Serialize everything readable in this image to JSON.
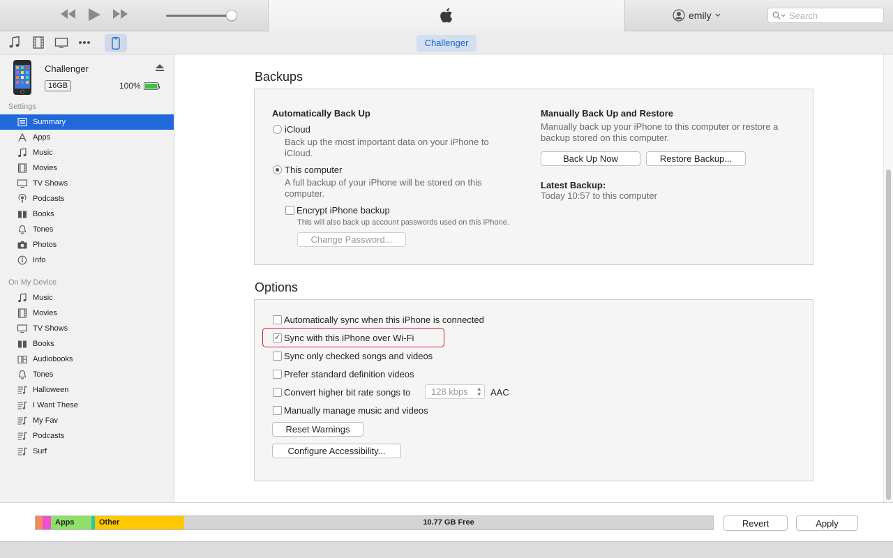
{
  "toolbar": {
    "icons": [
      "rewind-icon",
      "play-icon",
      "fast-forward-icon"
    ],
    "user_name": "emily",
    "search_placeholder": "Search"
  },
  "subbar": {
    "device_tab": "Challenger"
  },
  "device": {
    "name": "Challenger",
    "capacity": "16GB",
    "battery": "100%"
  },
  "sidebar": {
    "settings_label": "Settings",
    "settings_items": [
      {
        "label": "Summary",
        "icon": "summary-icon",
        "active": true
      },
      {
        "label": "Apps",
        "icon": "apps-icon"
      },
      {
        "label": "Music",
        "icon": "music-note-icon"
      },
      {
        "label": "Movies",
        "icon": "film-icon"
      },
      {
        "label": "TV Shows",
        "icon": "tv-icon"
      },
      {
        "label": "Podcasts",
        "icon": "podcast-icon"
      },
      {
        "label": "Books",
        "icon": "book-icon"
      },
      {
        "label": "Tones",
        "icon": "bell-icon"
      },
      {
        "label": "Photos",
        "icon": "camera-icon"
      },
      {
        "label": "Info",
        "icon": "info-icon"
      }
    ],
    "device_label": "On My Device",
    "device_items": [
      {
        "label": "Music",
        "icon": "music-note-icon"
      },
      {
        "label": "Movies",
        "icon": "film-icon"
      },
      {
        "label": "TV Shows",
        "icon": "tv-icon"
      },
      {
        "label": "Books",
        "icon": "book-icon"
      },
      {
        "label": "Audiobooks",
        "icon": "audiobook-icon"
      },
      {
        "label": "Tones",
        "icon": "bell-icon"
      },
      {
        "label": "Halloween",
        "icon": "playlist-icon"
      },
      {
        "label": "I Want These",
        "icon": "playlist-icon"
      },
      {
        "label": "My Fav",
        "icon": "playlist-icon"
      },
      {
        "label": "Podcasts",
        "icon": "playlist-icon"
      },
      {
        "label": "Surf",
        "icon": "playlist-icon"
      }
    ]
  },
  "backups": {
    "title": "Backups",
    "auto_title": "Automatically Back Up",
    "icloud_label": "iCloud",
    "icloud_desc_1": "Back up the most important data on your iPhone to",
    "icloud_desc_2": "iCloud.",
    "computer_label": "This computer",
    "computer_desc_1": "A full backup of your iPhone will be stored on this",
    "computer_desc_2": "computer.",
    "encrypt_label": "Encrypt iPhone backup",
    "encrypt_desc": "This will also back up account passwords used on this iPhone.",
    "change_password": "Change Password...",
    "manual_title": "Manually Back Up and Restore",
    "manual_desc_1": "Manually back up your iPhone to this computer or restore a",
    "manual_desc_2": "backup stored on this computer.",
    "backup_now": "Back Up Now",
    "restore_backup": "Restore Backup...",
    "latest_title": "Latest Backup:",
    "latest_value": "Today 10:57 to this computer"
  },
  "options": {
    "title": "Options",
    "auto_sync": "Automatically sync when this iPhone is connected",
    "wifi_sync": "Sync with this iPhone over Wi-Fi",
    "checked_only": "Sync only checked songs and videos",
    "standard_def": "Prefer standard definition videos",
    "convert_bitrate": "Convert higher bit rate songs to",
    "bitrate_value": "128 kbps",
    "bitrate_format": "AAC",
    "manual_manage": "Manually manage music and videos",
    "reset_warnings": "Reset Warnings",
    "configure_accessibility": "Configure Accessibility..."
  },
  "footer": {
    "apps_label": "Apps",
    "other_label": "Other",
    "free_label": "10.77 GB Free",
    "revert": "Revert",
    "apply": "Apply",
    "colors": {
      "audio": "#f08a5d",
      "photos": "#f050d0",
      "apps": "#8ee06a",
      "docs": "#30c4a0",
      "other": "#ffc800"
    }
  }
}
